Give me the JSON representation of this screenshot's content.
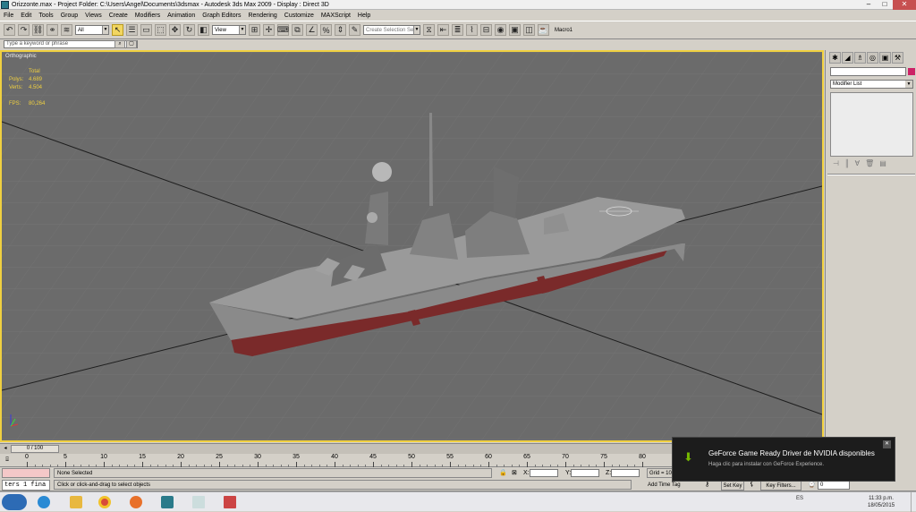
{
  "window": {
    "title": "Orizzonte.max    - Project Folder: C:\\Users\\Angel\\Documents\\3dsmax    - Autodesk 3ds Max  2009      - Display : Direct 3D",
    "minimize": "–",
    "maximize": "□",
    "close": "✕"
  },
  "menu": [
    "File",
    "Edit",
    "Tools",
    "Group",
    "Views",
    "Create",
    "Modifiers",
    "Animation",
    "Graph Editors",
    "Rendering",
    "Customize",
    "MAXScript",
    "Help"
  ],
  "toolbar": {
    "filter_value": "All",
    "refcoord_value": "View",
    "selection_set_placeholder": "Create Selection Set",
    "macro_label": "Macro1"
  },
  "search": {
    "placeholder": "Type a keyword or phrase"
  },
  "viewport": {
    "label": "Orthographic",
    "stats": {
      "header": "Total",
      "polys_label": "Polys:",
      "polys": "4.689",
      "verts_label": "Verts:",
      "verts": "4.504",
      "fps_label": "FPS:",
      "fps": "80,264"
    }
  },
  "command_panel": {
    "modifier_list": "Modifier List"
  },
  "timeline": {
    "slider": "0 / 100",
    "ticks": [
      "0",
      "5",
      "10",
      "15",
      "20",
      "25",
      "30",
      "35",
      "40",
      "45",
      "50",
      "55",
      "60",
      "65",
      "70",
      "75",
      "80"
    ]
  },
  "status": {
    "selection": "None Selected",
    "prompt": "Click or click-and-drag to select objects",
    "x_label": "X:",
    "y_label": "Y:",
    "z_label": "Z:",
    "grid": "Grid = 10,0",
    "add_time_tag": "Add Time Tag",
    "set_key": "Set Key",
    "key_filters": "Key Filters...",
    "frame": "0",
    "listener_text": "ters 1 fina"
  },
  "notification": {
    "title": "GeForce Game Ready Driver de NVIDIA disponibles",
    "subtitle": "Haga clic para instalar con GeForce Experience.",
    "close": "✕"
  },
  "taskbar": {
    "lang": "ES",
    "time": "11:33 p.m.",
    "date": "18/05/2015"
  },
  "colors": {
    "viewport_bg": "#6b6b6b",
    "active_border": "#f0d040",
    "nvidia_green": "#76b900"
  }
}
